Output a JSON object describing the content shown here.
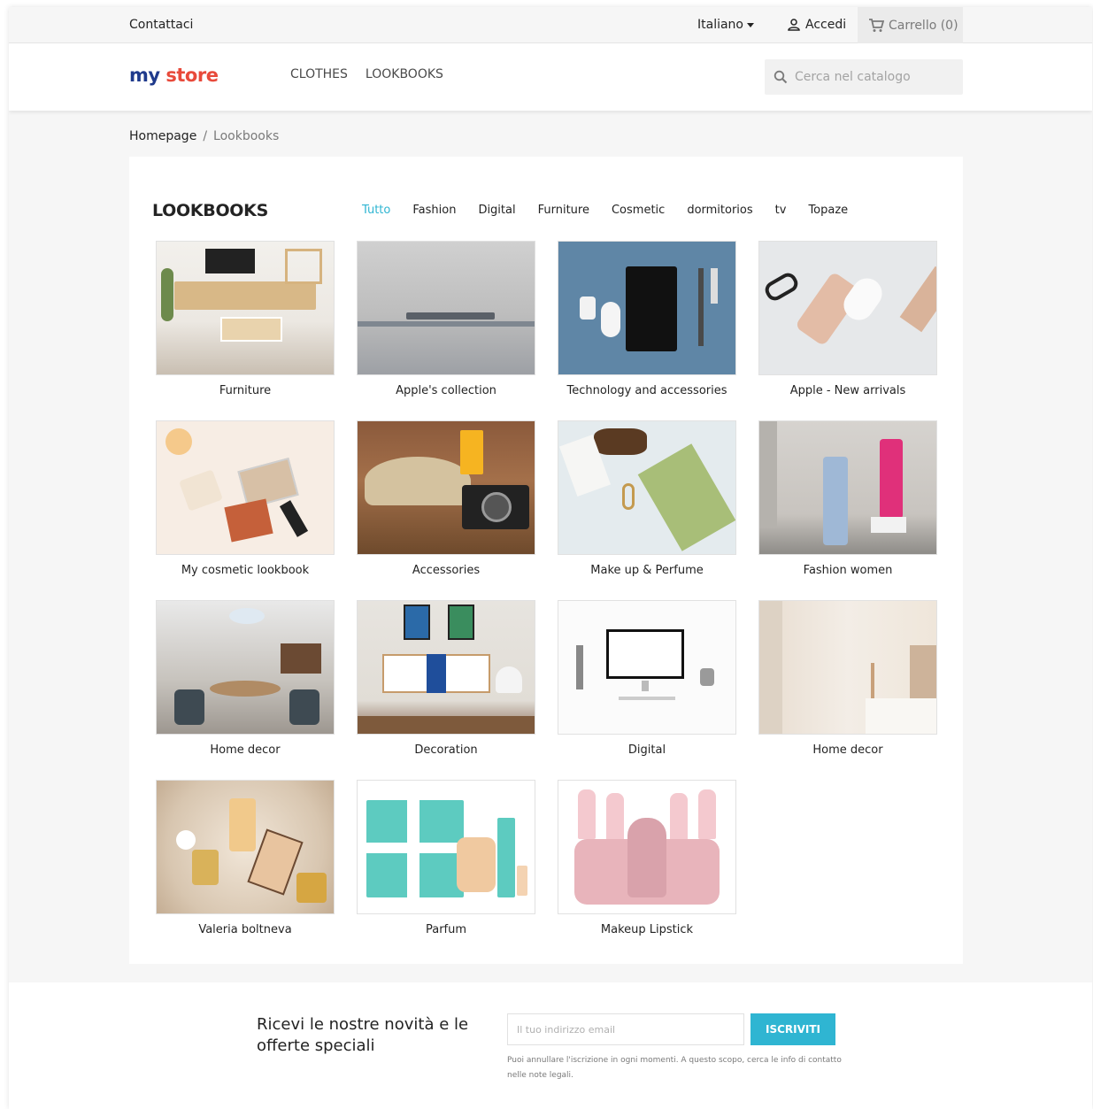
{
  "topbar": {
    "contact": "Contattaci",
    "language": "Italiano",
    "login": "Accedi",
    "cart": "Carrello (0)"
  },
  "header": {
    "logo": {
      "part1": "my",
      "part2": "store"
    },
    "nav": [
      "CLOTHES",
      "LOOKBOOKS"
    ],
    "search_placeholder": "Cerca nel catalogo"
  },
  "breadcrumb": {
    "home": "Homepage",
    "separator": "/",
    "current": "Lookbooks"
  },
  "lookbooks": {
    "title": "LOOKBOOKS",
    "filters": [
      "Tutto",
      "Fashion",
      "Digital",
      "Furniture",
      "Cosmetic",
      "dormitorios",
      "tv",
      "Topaze"
    ],
    "active_filter": "Tutto",
    "items": [
      {
        "caption": "Furniture"
      },
      {
        "caption": "Apple's collection"
      },
      {
        "caption": "Technology and accessories"
      },
      {
        "caption": "Apple - New arrivals"
      },
      {
        "caption": "My cosmetic lookbook"
      },
      {
        "caption": "Accessories"
      },
      {
        "caption": "Make up & Perfume"
      },
      {
        "caption": "Fashion women"
      },
      {
        "caption": "Home decor"
      },
      {
        "caption": "Decoration"
      },
      {
        "caption": "Digital"
      },
      {
        "caption": "Home decor"
      },
      {
        "caption": "Valeria boltneva"
      },
      {
        "caption": "Parfum"
      },
      {
        "caption": "Makeup Lipstick"
      }
    ]
  },
  "newsletter": {
    "heading": "Ricevi le nostre novità e le offerte speciali",
    "email_placeholder": "Il tuo indirizzo email",
    "button": "ISCRIVITI",
    "note": "Puoi annullare l'iscrizione in ogni momenti. A questo scopo, cerca le info di contatto nelle note legali."
  },
  "colors": {
    "accent": "#2fb5d2",
    "text": "#232323",
    "muted": "#7a7a7a"
  }
}
